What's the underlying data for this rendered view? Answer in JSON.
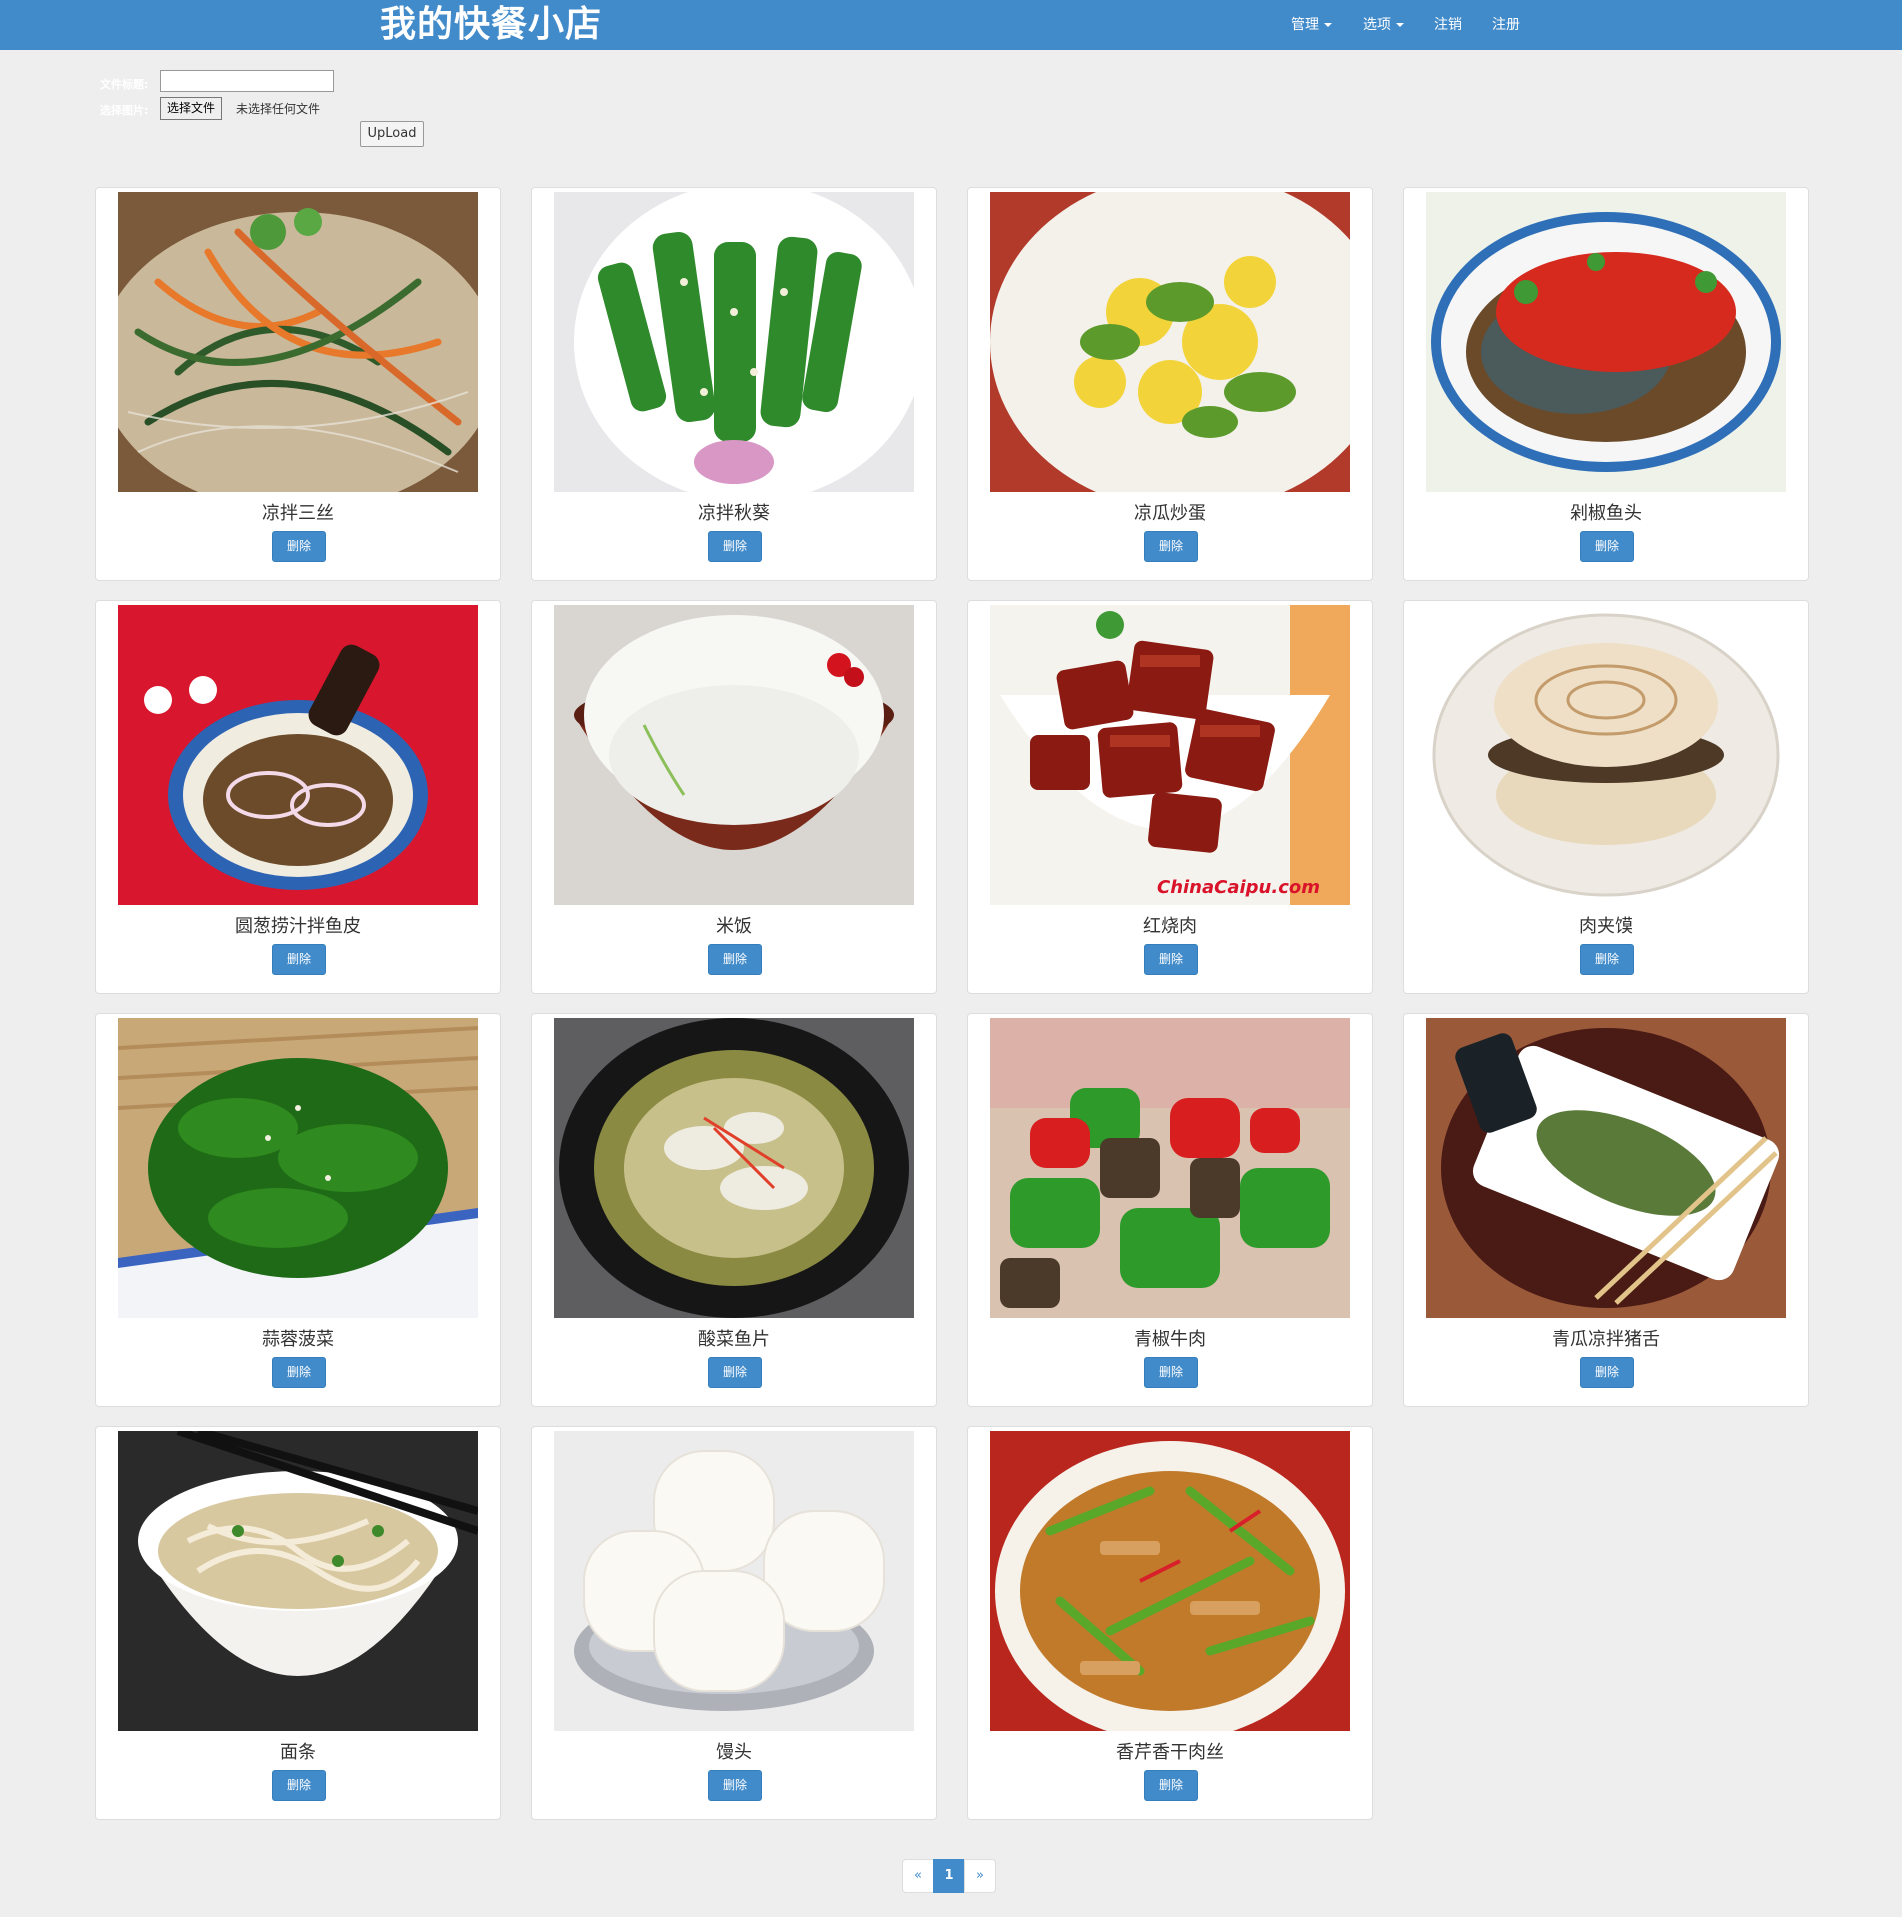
{
  "navbar": {
    "brand": "我的快餐小店",
    "manage": "管理",
    "options": "选项",
    "logout": "注销",
    "register": "注册",
    "bg_color": "#428bca"
  },
  "upload_form": {
    "title_label": "文件标题:",
    "image_label": "选择图片:",
    "choose_file": "选择文件",
    "no_file": "未选择任何文件",
    "upload": "UpLoad"
  },
  "dishes": [
    {
      "name": "凉拌三丝",
      "delete": "删除"
    },
    {
      "name": "凉拌秋葵",
      "delete": "删除"
    },
    {
      "name": "凉瓜炒蛋",
      "delete": "删除"
    },
    {
      "name": "剁椒鱼头",
      "delete": "删除"
    },
    {
      "name": "圆葱捞汁拌鱼皮",
      "delete": "删除"
    },
    {
      "name": "米饭",
      "delete": "删除"
    },
    {
      "name": "红烧肉",
      "delete": "删除"
    },
    {
      "name": "肉夹馍",
      "delete": "删除"
    },
    {
      "name": "蒜蓉菠菜",
      "delete": "删除"
    },
    {
      "name": "酸菜鱼片",
      "delete": "删除"
    },
    {
      "name": "青椒牛肉",
      "delete": "删除"
    },
    {
      "name": "青瓜凉拌猪舌",
      "delete": "删除"
    },
    {
      "name": "面条",
      "delete": "删除"
    },
    {
      "name": "馒头",
      "delete": "删除"
    },
    {
      "name": "香芹香干肉丝",
      "delete": "删除"
    }
  ],
  "pagination": {
    "prev": "«",
    "current": "1",
    "next": "»"
  }
}
